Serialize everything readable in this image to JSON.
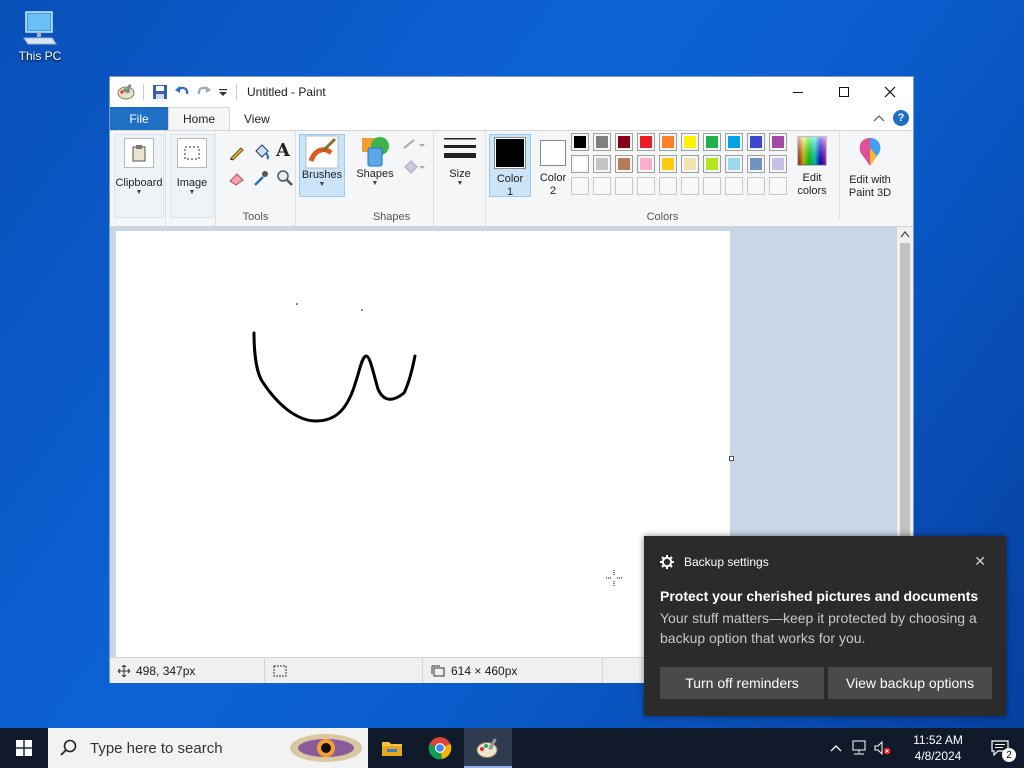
{
  "desktop": {
    "icon_label": "This PC"
  },
  "window": {
    "title": "Untitled - Paint",
    "controls": {
      "minimize": "—",
      "maximize": "☐",
      "close": "✕"
    }
  },
  "tabs": {
    "file": "File",
    "home": "Home",
    "view": "View",
    "help": "?"
  },
  "ribbon": {
    "clipboard": "Clipboard",
    "image": "Image",
    "tools_group": "Tools",
    "brushes": "Brushes",
    "shapes": "Shapes",
    "shapes_group": "Shapes",
    "size": "Size",
    "color1_line1": "Color",
    "color1_line2": "1",
    "color2_line1": "Color",
    "color2_line2": "2",
    "colors_group": "Colors",
    "edit_colors_line1": "Edit",
    "edit_colors_line2": "colors",
    "paint3d_line1": "Edit with",
    "paint3d_line2": "Paint 3D",
    "text_tool": "A"
  },
  "palette": {
    "row1": [
      "#000000",
      "#7f7f7f",
      "#880015",
      "#ed1c24",
      "#ff7f27",
      "#fff200",
      "#22b14c",
      "#00a2e8",
      "#3f48cc",
      "#a349a4"
    ],
    "row2": [
      "#ffffff",
      "#c3c3c3",
      "#b97a57",
      "#ffaec9",
      "#ffc90e",
      "#efe4b0",
      "#b5e61d",
      "#99d9ea",
      "#7092be",
      "#c8bfe7"
    ],
    "color1": "#000000",
    "color2": "#ffffff"
  },
  "status": {
    "cursor_pos": "498, 347px",
    "canvas_size": "614 × 460px"
  },
  "toast": {
    "app": "Backup settings",
    "close": "✕",
    "heading": "Protect your cherished pictures and documents",
    "body": "Your stuff matters—keep it protected by choosing a backup option that works for you.",
    "btn_off": "Turn off reminders",
    "btn_view": "View backup options"
  },
  "taskbar": {
    "search_placeholder": "Type here to search",
    "time": "11:52 AM",
    "date": "4/8/2024",
    "notification_count": "2"
  }
}
